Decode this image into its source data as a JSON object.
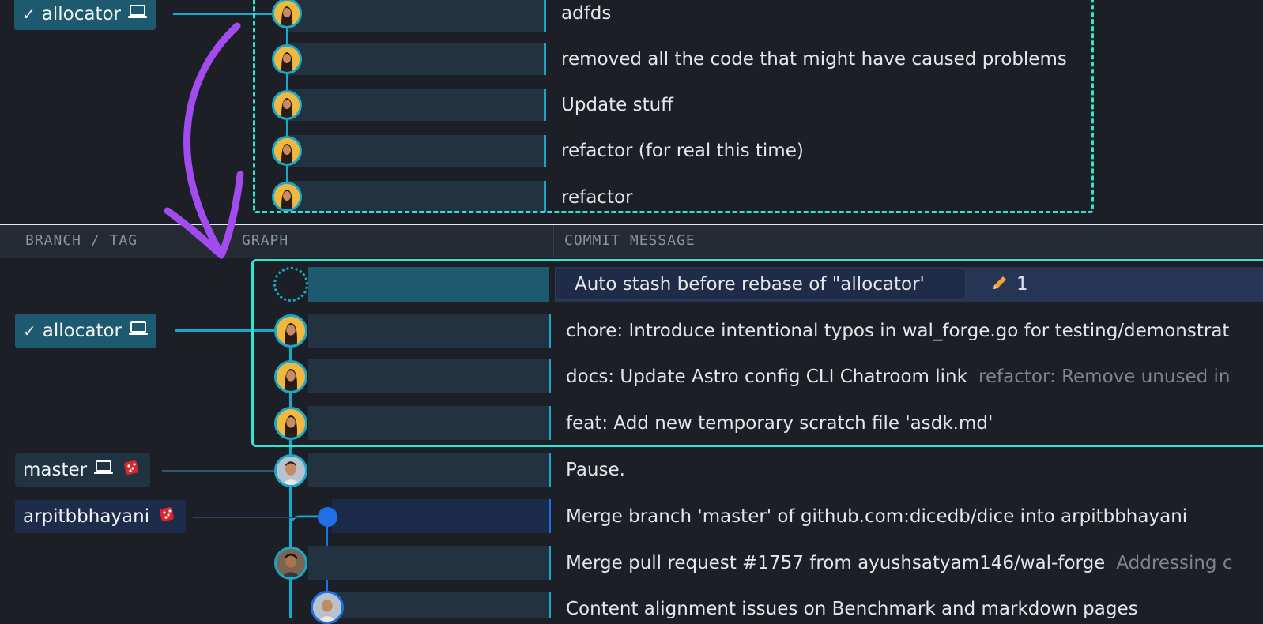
{
  "ghost": {
    "branch_label": "allocator",
    "commits": [
      {
        "message": "adfds"
      },
      {
        "message": "removed all the code that might have caused problems"
      },
      {
        "message": "Update stuff"
      },
      {
        "message": "refactor (for real this time)"
      },
      {
        "message": "refactor"
      }
    ]
  },
  "headers": {
    "branch_tag": "BRANCH / TAG",
    "graph": "GRAPH",
    "commit_message": "COMMIT MESSAGE"
  },
  "wip": {
    "message": "Auto stash before rebase of \"allocator'",
    "edit_count": "1"
  },
  "branches": {
    "allocator": "allocator",
    "master": "master",
    "arpit": "arpitbbhayani"
  },
  "commits": [
    {
      "message": "chore: Introduce intentional typos in wal_forge.go for testing/demonstrat",
      "sub": ""
    },
    {
      "message": "docs: Update Astro config CLI Chatroom link",
      "sub": "refactor: Remove unused in"
    },
    {
      "message": "feat: Add new temporary scratch file 'asdk.md'",
      "sub": ""
    },
    {
      "message": "Pause.",
      "sub": ""
    },
    {
      "message": "Merge branch 'master' of github.com:dicedb/dice into arpitbbhayani",
      "sub": ""
    },
    {
      "message": "Merge pull request #1757 from ayushsatyam146/wal-forge",
      "sub": "Addressing c"
    },
    {
      "message": "Content alignment issues on Benchmark and markdown pages",
      "sub": ""
    }
  ],
  "colors": {
    "accent": "#2ee6d6",
    "lane": "#17a9c9",
    "merge_lane": "#1f6fe6",
    "arrow": "#a24cf0",
    "branch_bg": "#1d5a70"
  },
  "icons": [
    "check-icon",
    "laptop-icon",
    "dice-icon",
    "pencil-icon"
  ]
}
